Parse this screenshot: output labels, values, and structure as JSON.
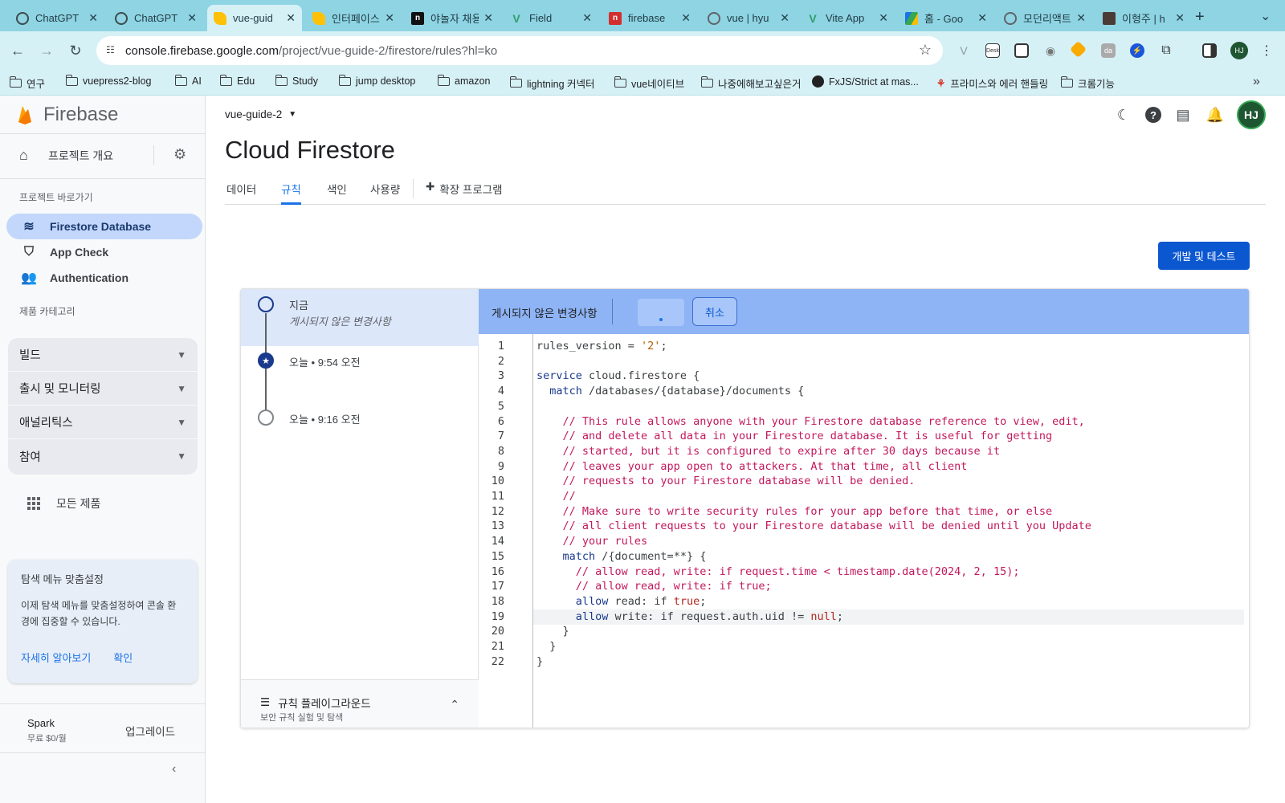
{
  "browser": {
    "tabs": [
      {
        "label": "ChatGPT",
        "icon": "chatgpt-icon"
      },
      {
        "label": "ChatGPT",
        "icon": "chatgpt-icon"
      },
      {
        "label": "vue-guid",
        "icon": "firebase-icon"
      },
      {
        "label": "인터페이스",
        "icon": "firebase-icon"
      },
      {
        "label": "야놀자 채용",
        "icon": "n-icon"
      },
      {
        "label": "Field",
        "icon": "vue-icon"
      },
      {
        "label": "firebase",
        "icon": "n-red-icon"
      },
      {
        "label": "vue | hyu",
        "icon": "globe-icon"
      },
      {
        "label": "Vite App",
        "icon": "vue-icon"
      },
      {
        "label": "홈 - Goo",
        "icon": "drive-icon"
      },
      {
        "label": "모던리액트",
        "icon": "globe-icon"
      },
      {
        "label": "이형주 | h",
        "icon": "profile-icon"
      }
    ],
    "close_glyph": "✕",
    "new_tab": "+",
    "url_host": "console.firebase.google.com",
    "url_path": "/project/vue-guide-2/firestore/rules?hl=ko",
    "profile_initials": "HJ",
    "bookmarks": [
      {
        "label": "연구",
        "icon": "folder-icon"
      },
      {
        "label": "vuepress2-blog",
        "icon": "folder-icon"
      },
      {
        "label": "AI",
        "icon": "folder-icon"
      },
      {
        "label": "Edu",
        "icon": "folder-icon"
      },
      {
        "label": "Study",
        "icon": "folder-icon"
      },
      {
        "label": "jump desktop",
        "icon": "folder-icon"
      },
      {
        "label": "amazon",
        "icon": "folder-icon"
      },
      {
        "label": "lightning 커넥터",
        "icon": "folder-icon"
      },
      {
        "label": "vue네이티브",
        "icon": "folder-icon"
      },
      {
        "label": "나중에해보고싶은거",
        "icon": "folder-icon"
      },
      {
        "label": "FxJS/Strict at mas...",
        "icon": "github-icon"
      },
      {
        "label": "프라미스와 에러 핸들링",
        "icon": "javascript-info-icon"
      },
      {
        "label": "크롬기능",
        "icon": "folder-icon"
      }
    ]
  },
  "sidebar": {
    "brand": "Firebase",
    "overview": "프로젝트 개요",
    "shortcuts_caption": "프로젝트 바로가기",
    "shortcuts": [
      {
        "label": "Firestore Database",
        "icon": "firestore-icon",
        "active": true
      },
      {
        "label": "App Check",
        "icon": "shield-icon",
        "active": false
      },
      {
        "label": "Authentication",
        "icon": "people-icon",
        "active": false
      }
    ],
    "category_caption": "제품 카테고리",
    "categories": [
      "빌드",
      "출시 및 모니터링",
      "애널리틱스",
      "참여"
    ],
    "all_products": "모든 제품",
    "card": {
      "title": "탐색 메뉴 맞춤설정",
      "body": "이제 탐색 메뉴를 맞춤설정하여 콘솔 환경에 집중할 수 있습니다.",
      "learn_more": "자세히 알아보기",
      "confirm": "확인"
    },
    "plan_name": "Spark",
    "plan_price": "무료 $0/월",
    "upgrade": "업그레이드"
  },
  "main": {
    "project": "vue-guide-2",
    "title": "Cloud Firestore",
    "tabs": [
      "데이터",
      "규칙",
      "색인",
      "사용량",
      "확장 프로그램"
    ],
    "active_tab": "규칙",
    "dev_button": "개발 및 테스트",
    "history": {
      "current_label": "지금",
      "current_sub": "게시되지 않은 변경사항",
      "entries": [
        "오늘 • 9:54 오전",
        "오늘 • 9:16 오전"
      ]
    },
    "playground_title": "규칙 플레이그라운드",
    "playground_sub": "보안 규칙 실험 및 탐색",
    "editor_status": "게시되지 않은 변경사항",
    "cancel": "취소",
    "highlighted_line": 19,
    "code_lines": [
      "rules_version = '2';",
      "",
      "service cloud.firestore {",
      "  match /databases/{database}/documents {",
      "",
      "    // This rule allows anyone with your Firestore database reference to view, edit,",
      "    // and delete all data in your Firestore database. It is useful for getting",
      "    // started, but it is configured to expire after 30 days because it",
      "    // leaves your app open to attackers. At that time, all client",
      "    // requests to your Firestore database will be denied.",
      "    //",
      "    // Make sure to write security rules for your app before that time, or else",
      "    // all client requests to your Firestore database will be denied until you Update",
      "    // your rules",
      "    match /{document=**} {",
      "      // allow read, write: if request.time < timestamp.date(2024, 2, 15);",
      "      // allow read, write: if true;",
      "      allow read: if true;",
      "      allow write: if request.auth.uid != null;",
      "    }",
      "  }",
      "}"
    ]
  }
}
